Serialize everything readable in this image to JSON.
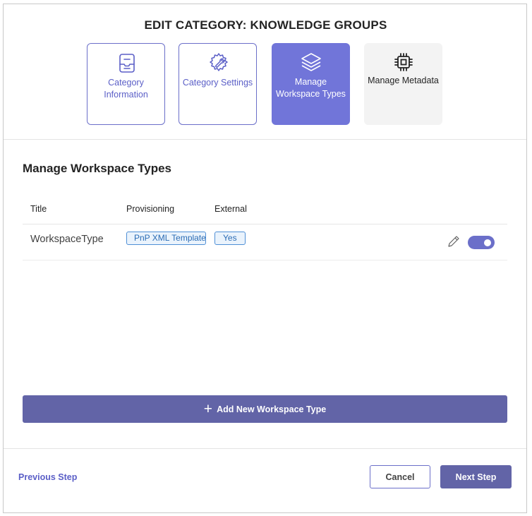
{
  "dialog": {
    "title": "EDIT CATEGORY: KNOWLEDGE GROUPS"
  },
  "steps": [
    {
      "label": "Category Information",
      "icon": "inbox-tray-icon",
      "state": "completed"
    },
    {
      "label": "Category Settings",
      "icon": "wrench-settings-icon",
      "state": "completed"
    },
    {
      "label": "Manage Workspace Types",
      "icon": "layers-icon",
      "state": "active"
    },
    {
      "label": "Manage Metadata",
      "icon": "chip-icon",
      "state": "upcoming"
    }
  ],
  "section": {
    "title": "Manage Workspace Types"
  },
  "table": {
    "columns": [
      "Title",
      "Provisioning",
      "External"
    ],
    "rows": [
      {
        "title": "WorkspaceType",
        "provisioning": "PnP XML Template",
        "external": "Yes",
        "enabled": true
      }
    ]
  },
  "actions": {
    "add_label": "Add New Workspace Type",
    "previous_label": "Previous Step",
    "cancel_label": "Cancel",
    "next_label": "Next Step"
  },
  "colors": {
    "accent": "#6264a7",
    "step_active": "#7175d9",
    "tag_border": "#4f8fd6",
    "tag_background": "#eaf3fc"
  }
}
